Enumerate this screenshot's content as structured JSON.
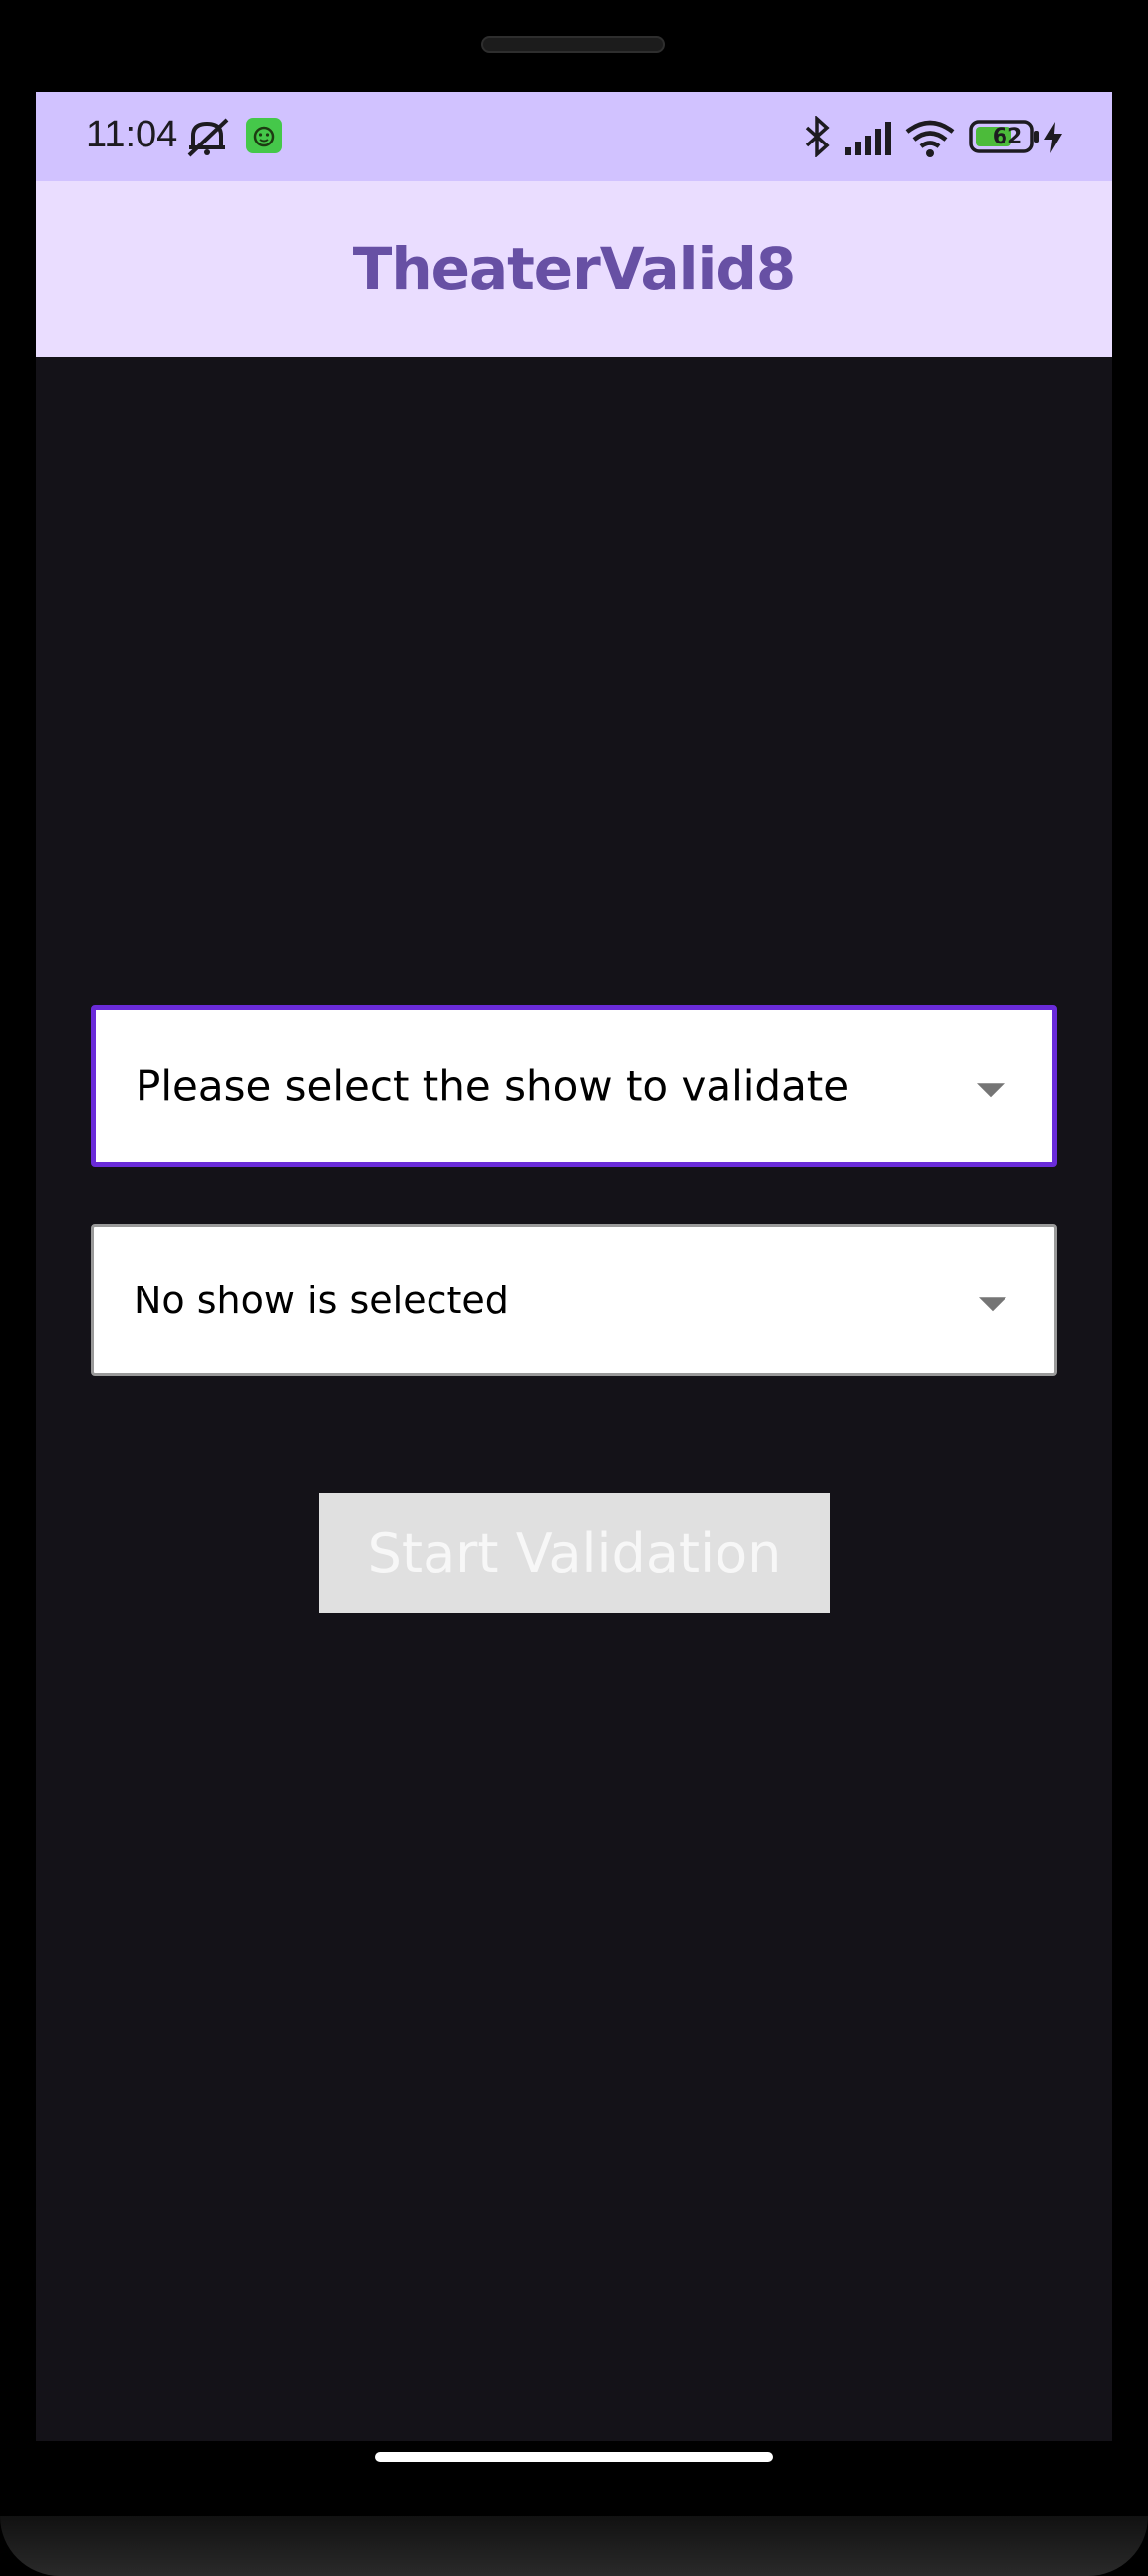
{
  "status_bar": {
    "time": "11:04",
    "battery_level": "62",
    "icons": [
      "mute-icon",
      "app-notification-icon",
      "bluetooth-icon",
      "signal-icon",
      "wifi-icon",
      "battery-icon",
      "charging-icon"
    ],
    "background_color": "#d1c2ff"
  },
  "app_bar": {
    "title": "TheaterValid8",
    "background_color": "#eaddff",
    "title_color": "#6750a4"
  },
  "main": {
    "show_dropdown": {
      "label": "Please select the show to validate",
      "accent_color": "#6a2bd9"
    },
    "selection_dropdown": {
      "label": "No show is selected"
    },
    "start_button": {
      "label": "Start Validation",
      "state": "disabled"
    },
    "background_color": "#141218"
  }
}
